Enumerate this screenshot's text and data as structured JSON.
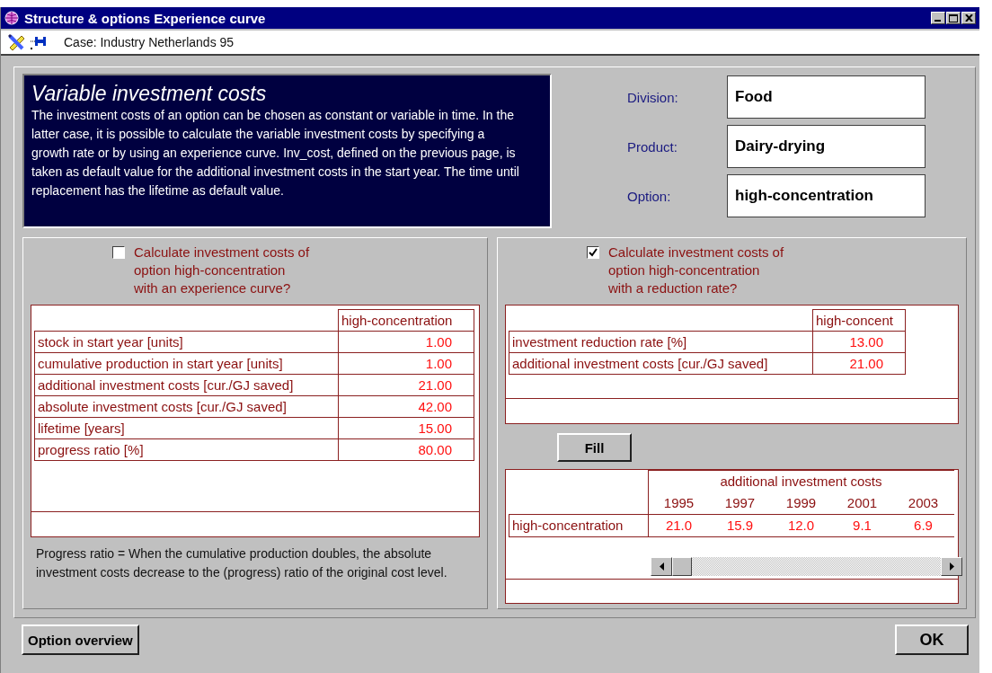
{
  "window": {
    "title": "Structure & options Experience curve"
  },
  "toolbar": {
    "case_label": "Case: Industry Netherlands 95"
  },
  "info": {
    "title": "Variable investment costs",
    "text": "The investment costs of an option can be chosen as constant or variable in time. In the latter case, it is possible to calculate the variable investment costs by specifying a growth rate or by using an experience curve. Inv_cost, defined on the previous page, is taken as default value for the additional investment costs in the start year. The time until replacement has the lifetime as default value."
  },
  "fields": [
    {
      "label": "Division:",
      "value": "Food"
    },
    {
      "label": "Product:",
      "value": "Dairy-drying"
    },
    {
      "label": "Option:",
      "value": "high-concentration"
    }
  ],
  "left_panel": {
    "checkbox": {
      "label": "Calculate investment costs of\noption high-concentration\nwith an experience curve?",
      "checked": false
    },
    "table": {
      "columns": [
        "high-concentration"
      ],
      "rows": [
        {
          "label": "stock in start year [units]",
          "value": "1.00"
        },
        {
          "label": "cumulative production in start year [units]",
          "value": "1.00"
        },
        {
          "label": "additional investment costs [cur./GJ saved]",
          "value": "21.00"
        },
        {
          "label": "absolute investment costs [cur./GJ saved]",
          "value": "42.00"
        },
        {
          "label": "lifetime [years]",
          "value": "15.00"
        },
        {
          "label": "progress ratio [%]",
          "value": "80.00"
        }
      ]
    },
    "note": "Progress ratio = When the cumulative production doubles,  the absolute investment costs decrease to the (progress) ratio of the original cost level."
  },
  "right_panel": {
    "checkbox": {
      "label": "Calculate investment costs of\noption high-concentration\nwith a reduction rate?",
      "checked": true
    },
    "table": {
      "columns": [
        "high-concent"
      ],
      "rows": [
        {
          "label": "investment reduction rate [%]",
          "value": "13.00"
        },
        {
          "label": "additional investment costs [cur./GJ saved]",
          "value": "21.00"
        }
      ]
    },
    "fill_button": "Fill",
    "years_table": {
      "group_header": "additional investment costs",
      "columns": [
        "1995",
        "1997",
        "1999",
        "2001",
        "2003"
      ],
      "rows": [
        {
          "label": "high-concentration",
          "values": [
            "21.0",
            "15.9",
            "12.0",
            "9.1",
            "6.9"
          ]
        }
      ]
    }
  },
  "buttons": [
    {
      "label": "Option overview"
    },
    {
      "label": "OK"
    }
  ]
}
